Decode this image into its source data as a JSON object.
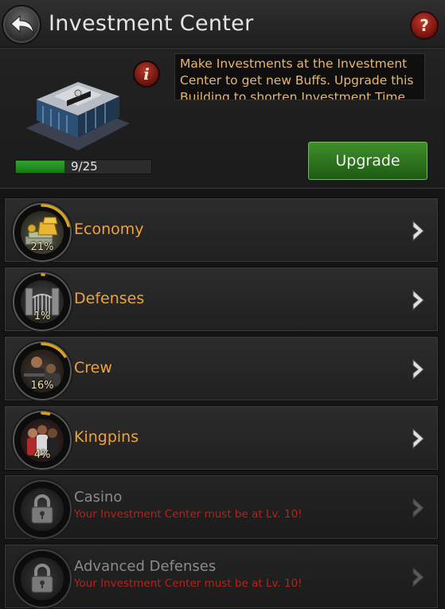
{
  "header": {
    "title": "Investment Center"
  },
  "info": {
    "description": "Make Investments at the Investment Center to get new Buffs. Upgrade this Building to shorten Investment Time",
    "level_text": "9/25",
    "level_progress": 0.36,
    "upgrade_label": "Upgrade"
  },
  "categories": [
    {
      "name": "Economy",
      "percent": "21%",
      "progress": 0.21
    },
    {
      "name": "Defenses",
      "percent": "1%",
      "progress": 0.01
    },
    {
      "name": "Crew",
      "percent": "16%",
      "progress": 0.16
    },
    {
      "name": "Kingpins",
      "percent": "4%",
      "progress": 0.04
    },
    {
      "name": "Casino",
      "locked": true,
      "requirement": "Your Investment Center must be at Lv. 10!"
    },
    {
      "name": "Advanced Defenses",
      "locked": true,
      "requirement": "Your Investment Center must be at Lv. 10!"
    }
  ],
  "colors": {
    "accent_orange": "#f0a23a",
    "progress_yellow": "#d8a21e",
    "locked_red": "#b4241c",
    "upgrade_green": "#2f7a1f"
  }
}
